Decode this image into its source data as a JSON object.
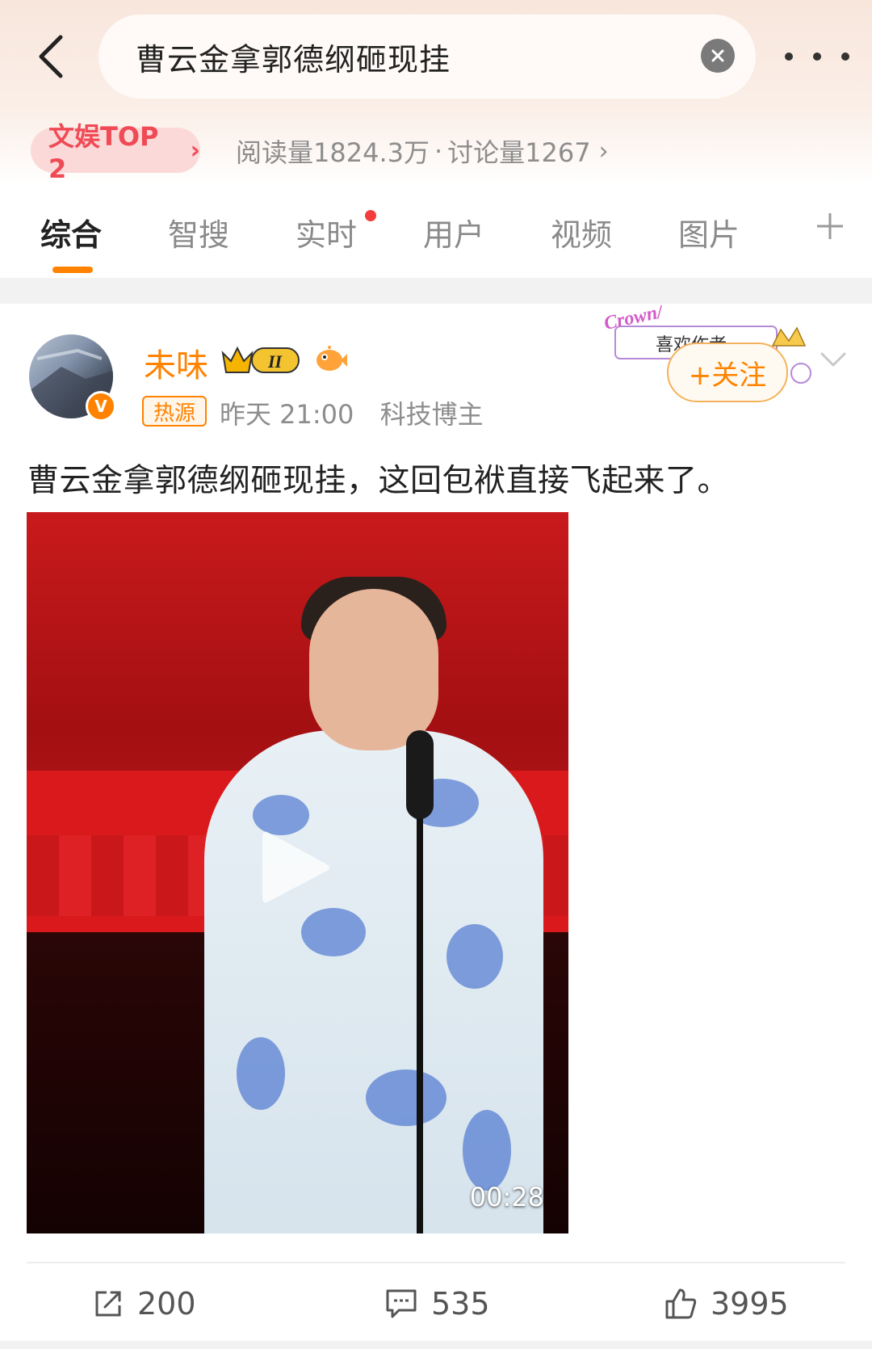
{
  "search": {
    "query": "曹云金拿郭德纲砸现挂"
  },
  "topic": {
    "rank_label": "文娱TOP 2",
    "reads": "阅读量1824.3万",
    "separator": "·",
    "discussions": "讨论量1267"
  },
  "tabs": [
    {
      "label": "综合",
      "active": true
    },
    {
      "label": "智搜"
    },
    {
      "label": "实时",
      "has_dot": true
    },
    {
      "label": "用户"
    },
    {
      "label": "视频"
    },
    {
      "label": "图片"
    }
  ],
  "post": {
    "username": "未味",
    "level_badge": "II",
    "hot_tag": "热源",
    "time": "昨天 21:00",
    "category": "科技博主",
    "follow_label": "+关注",
    "deco_text": "Crown/ 喜欢作者",
    "text": "曹云金拿郭德纲砸现挂，这回包袱直接飞起来了。",
    "video_duration": "00:28"
  },
  "actions": {
    "reposts": "200",
    "comments": "535",
    "likes": "3995"
  },
  "colors": {
    "accent": "#ff8200",
    "rank_red": "#f04a55",
    "dot_red": "#f33d3d"
  }
}
